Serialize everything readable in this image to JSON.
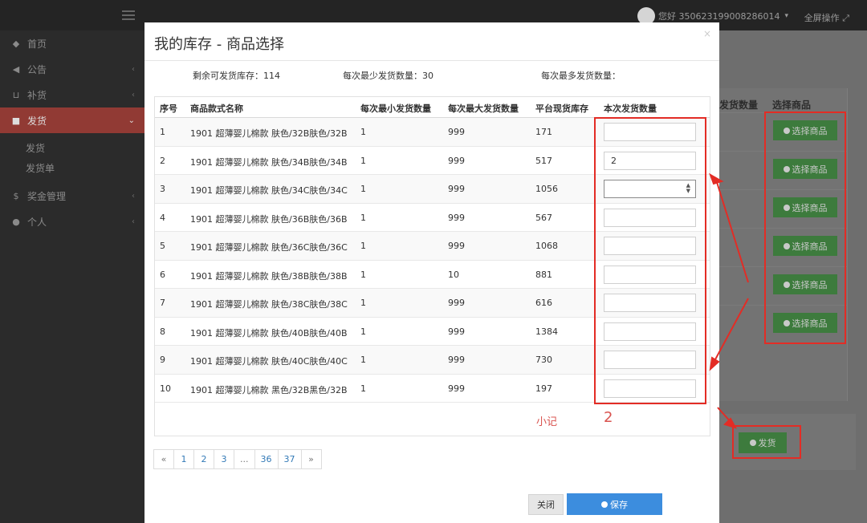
{
  "header": {
    "greeting": "您好 350623199008286014",
    "fullscreen_label": "全屏操作"
  },
  "sidebar": {
    "items": [
      {
        "label": "首页",
        "icon": "diamond-icon"
      },
      {
        "label": "公告",
        "icon": "megaphone-icon"
      },
      {
        "label": "补货",
        "icon": "cart-icon"
      },
      {
        "label": "发货",
        "icon": "truck-icon"
      },
      {
        "label": "奖金管理",
        "icon": "dollar-icon"
      },
      {
        "label": "个人",
        "icon": "user-icon"
      }
    ],
    "subitems": [
      {
        "label": "发货"
      },
      {
        "label": "发货单"
      }
    ]
  },
  "background": {
    "col_qty_header": "发货数量",
    "col_pick_header": "选择商品",
    "pick_label": "选择商品",
    "ship_label": "发货"
  },
  "modal": {
    "title": "我的库存 - 商品选择",
    "close_glyph": "×",
    "info": {
      "remaining": "剩余可发货库存：114",
      "min_qty": "每次最少发货数量：30",
      "max_qty": "每次最多发货数量："
    },
    "columns": [
      "序号",
      "商品款式名称",
      "每次最小发货数量",
      "每次最大发货数量",
      "平台现货库存",
      "本次发货数量"
    ],
    "rows": [
      {
        "no": "1",
        "name": "1901 超薄婴儿棉款 肤色/32B肤色/32B",
        "min": "1",
        "max": "999",
        "stock": "171",
        "qty": ""
      },
      {
        "no": "2",
        "name": "1901 超薄婴儿棉款 肤色/34B肤色/34B",
        "min": "1",
        "max": "999",
        "stock": "517",
        "qty": "2"
      },
      {
        "no": "3",
        "name": "1901 超薄婴儿棉款 肤色/34C肤色/34C",
        "min": "1",
        "max": "999",
        "stock": "1056",
        "qty": ""
      },
      {
        "no": "4",
        "name": "1901 超薄婴儿棉款 肤色/36B肤色/36B",
        "min": "1",
        "max": "999",
        "stock": "567",
        "qty": ""
      },
      {
        "no": "5",
        "name": "1901 超薄婴儿棉款 肤色/36C肤色/36C",
        "min": "1",
        "max": "999",
        "stock": "1068",
        "qty": ""
      },
      {
        "no": "6",
        "name": "1901 超薄婴儿棉款 肤色/38B肤色/38B",
        "min": "1",
        "max": "10",
        "stock": "881",
        "qty": ""
      },
      {
        "no": "7",
        "name": "1901 超薄婴儿棉款 肤色/38C肤色/38C",
        "min": "1",
        "max": "999",
        "stock": "616",
        "qty": ""
      },
      {
        "no": "8",
        "name": "1901 超薄婴儿棉款 肤色/40B肤色/40B",
        "min": "1",
        "max": "999",
        "stock": "1384",
        "qty": ""
      },
      {
        "no": "9",
        "name": "1901 超薄婴儿棉款 肤色/40C肤色/40C",
        "min": "1",
        "max": "999",
        "stock": "730",
        "qty": ""
      },
      {
        "no": "10",
        "name": "1901 超薄婴儿棉款 黑色/32B黑色/32B",
        "min": "1",
        "max": "999",
        "stock": "197",
        "qty": ""
      }
    ],
    "subtotal_label": "小记",
    "subtotal_value": "2",
    "pagination": [
      "«",
      "1",
      "2",
      "3",
      "...",
      "36",
      "37",
      "»"
    ],
    "close_button": "关闭",
    "save_button": "保存"
  },
  "colors": {
    "accent_red": "#e32c25",
    "primary_blue": "#3c8dde",
    "success_green": "#3d7b3d",
    "sidebar_active": "#913a34"
  }
}
